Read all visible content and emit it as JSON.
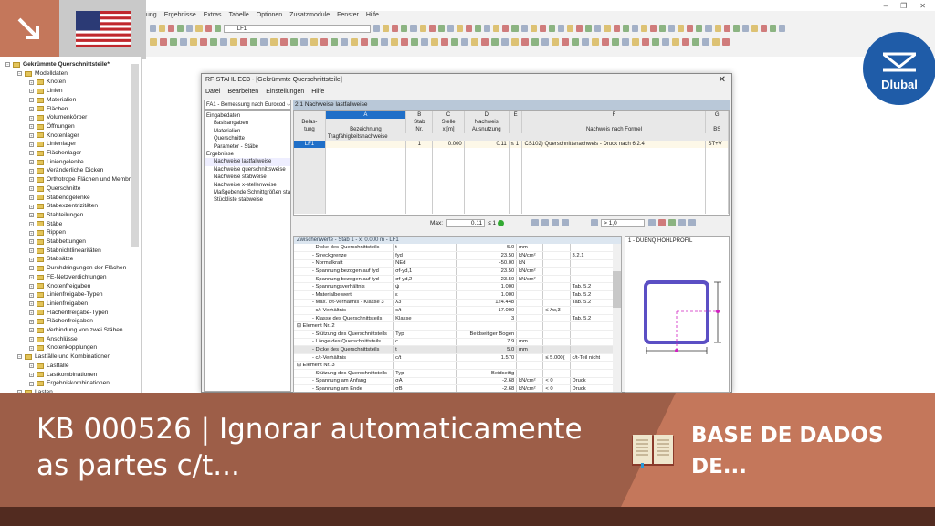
{
  "app": {
    "menu": [
      "ung",
      "Ergebnisse",
      "Extras",
      "Tabelle",
      "Optionen",
      "Zusatzmodule",
      "Fenster",
      "Hilfe"
    ],
    "loadcase_combo": "LF1"
  },
  "logo": {
    "text": "Dlubal",
    "color": "#1f5ca8"
  },
  "tree": {
    "items": [
      {
        "label": "Gekrümmte Querschnittsteile*",
        "level": 0
      },
      {
        "label": "Modelldaten",
        "level": 1
      },
      {
        "label": "Knoten",
        "level": 2
      },
      {
        "label": "Linien",
        "level": 2
      },
      {
        "label": "Materialien",
        "level": 2
      },
      {
        "label": "Flächen",
        "level": 2
      },
      {
        "label": "Volumenkörper",
        "level": 2
      },
      {
        "label": "Öffnungen",
        "level": 2
      },
      {
        "label": "Knotenlager",
        "level": 2
      },
      {
        "label": "Linienlager",
        "level": 2
      },
      {
        "label": "Flächenlager",
        "level": 2
      },
      {
        "label": "Liniengelenke",
        "level": 2
      },
      {
        "label": "Veränderliche Dicken",
        "level": 2
      },
      {
        "label": "Orthotrope Flächen und Membrar",
        "level": 2
      },
      {
        "label": "Querschnitte",
        "level": 2
      },
      {
        "label": "Stabendgelenke",
        "level": 2
      },
      {
        "label": "Stabexzentrizitäten",
        "level": 2
      },
      {
        "label": "Stabteilungen",
        "level": 2
      },
      {
        "label": "Stäbe",
        "level": 2
      },
      {
        "label": "Rippen",
        "level": 2
      },
      {
        "label": "Stabbettungen",
        "level": 2
      },
      {
        "label": "Stabnichtlinearitäten",
        "level": 2
      },
      {
        "label": "Stabsätze",
        "level": 2
      },
      {
        "label": "Durchdringungen der Flächen",
        "level": 2
      },
      {
        "label": "FE-Netzverdichtungen",
        "level": 2
      },
      {
        "label": "Knotenfreigaben",
        "level": 2
      },
      {
        "label": "Linienfreigabe-Typen",
        "level": 2
      },
      {
        "label": "Linienfreigaben",
        "level": 2
      },
      {
        "label": "Flächenfreigabe-Typen",
        "level": 2
      },
      {
        "label": "Flächenfreigaben",
        "level": 2
      },
      {
        "label": "Verbindung von zwei Stäben",
        "level": 2
      },
      {
        "label": "Anschlüsse",
        "level": 2
      },
      {
        "label": "Knotenkopplungen",
        "level": 2
      },
      {
        "label": "Lastfälle und Kombinationen",
        "level": 1
      },
      {
        "label": "Lastfälle",
        "level": 2
      },
      {
        "label": "Lastkombinationen",
        "level": 2
      },
      {
        "label": "Ergebniskombinationen",
        "level": 2
      },
      {
        "label": "Lasten",
        "level": 1
      }
    ]
  },
  "dialog": {
    "title": "RF-STAHL EC3 - [Gekrümmte Querschnittsteile]",
    "close": "✕",
    "menu": [
      "Datei",
      "Bearbeiten",
      "Einstellungen",
      "Hilfe"
    ],
    "case_combo": "FA1 - Bemessung nach Eurocod ⌵",
    "nav": [
      {
        "label": "Eingabedaten",
        "level": 0
      },
      {
        "label": "Basisangaben",
        "level": 1
      },
      {
        "label": "Materialien",
        "level": 1
      },
      {
        "label": "Querschnitte",
        "level": 1
      },
      {
        "label": "Parameter - Stäbe",
        "level": 1
      },
      {
        "label": "Ergebnisse",
        "level": 0
      },
      {
        "label": "Nachweise lastfallweise",
        "level": 1
      },
      {
        "label": "Nachweise querschnittsweise",
        "level": 1
      },
      {
        "label": "Nachweise stabweise",
        "level": 1
      },
      {
        "label": "Nachweise x-stellenweise",
        "level": 1
      },
      {
        "label": "Maßgebende Schnittgrößen sta",
        "level": 1
      },
      {
        "label": "Stückliste stabweise",
        "level": 1
      }
    ],
    "section_title": "2.1 Nachweise lastfallweise",
    "table": {
      "letters": [
        "",
        "A",
        "B",
        "C",
        "D",
        "E",
        "F",
        "G"
      ],
      "headers1": [
        "Belas-",
        "",
        "Stab",
        "Stelle",
        "Nachweis",
        "",
        "",
        ""
      ],
      "headers2": [
        "tung",
        "Bezeichnung",
        "Nr.",
        "x [m]",
        "Ausnutzung",
        "",
        "Nachweis nach Formel",
        "BS"
      ],
      "group": "Tragfähigkeitsnachweise",
      "rows": [
        [
          "LF1",
          "",
          "1",
          "0.000",
          "0.11",
          "≤ 1",
          "CS102) Querschnittsnachweis - Druck nach 6.2.4",
          "ST+V"
        ]
      ]
    },
    "max_label": "Max:",
    "max_value": "0.11",
    "max_le": "≤ 1",
    "filter": "> 1,0",
    "intermediate": {
      "title": "Zwischenwerte - Stab 1 - x: 0.000 m - LF1",
      "rows": [
        [
          "- Dicke des Querschnittsteils",
          "t",
          "5.0",
          "mm",
          "",
          ""
        ],
        [
          "- Streckgrenze",
          "fyd",
          "23.50",
          "kN/cm²",
          "",
          "3.2.1"
        ],
        [
          "- Normalkraft",
          "NEd",
          "-50.00",
          "kN",
          "",
          ""
        ],
        [
          "- Spannung bezogen auf fyd",
          "σf-yd,1",
          "23.50",
          "kN/cm²",
          "",
          ""
        ],
        [
          "- Spannung bezogen auf fyd",
          "σf-yd,2",
          "23.50",
          "kN/cm²",
          "",
          ""
        ],
        [
          "- Spannungsverhältnis",
          "ψ",
          "1.000",
          "",
          "",
          "Tab. 5.2"
        ],
        [
          "- Materialbeiwert",
          "ε",
          "1.000",
          "",
          "",
          "Tab. 5.2"
        ],
        [
          "- Max. c/t-Verhältnis - Klasse 3",
          "λ3",
          "124.448",
          "",
          "",
          "Tab. 5.2"
        ],
        [
          "- c/t-Verhältnis",
          "c/t",
          "17.000",
          "",
          "≤ λw,3",
          ""
        ],
        [
          "- Klasse des Querschnittsteils",
          "Klasse",
          "3",
          "",
          "",
          "Tab. 5.2"
        ],
        [
          "⊟ Element Nr. 2",
          "",
          "",
          "",
          "",
          ""
        ],
        [
          "- Stützung des Querschnittsteils",
          "Typ",
          "Beidseitiger Bogen",
          "",
          "",
          ""
        ],
        [
          "- Länge des Querschnittsteils",
          "c",
          "7.9",
          "mm",
          "",
          ""
        ],
        [
          "- Dicke des Querschnittsteils",
          "t",
          "5.0",
          "mm",
          "",
          ""
        ],
        [
          "- c/t-Verhältnis",
          "c/t",
          "1.570",
          "",
          "≤ 5.000(",
          "c/t-Teil nicht"
        ],
        [
          "⊟ Element Nr. 3",
          "",
          "",
          "",
          "",
          ""
        ],
        [
          "- Stützung des Querschnittsteils",
          "Typ",
          "Beidseitig",
          "",
          "",
          ""
        ],
        [
          "- Spannung am Anfang",
          "σA",
          "-2.68",
          "kN/cm²",
          "< 0",
          "Druck"
        ],
        [
          "- Spannung am Ende",
          "σB",
          "-2.68",
          "kN/cm²",
          "< 0",
          "Druck"
        ]
      ]
    },
    "profile_title": "1 - DUENQ HOHLPROFIL"
  },
  "banner": {
    "title": "KB 000526 | Ignorar automaticamente as partes c/t...",
    "category": "BASE DE DADOS DE...",
    "bg": "#9d5e48",
    "accent": "#c4775b"
  }
}
